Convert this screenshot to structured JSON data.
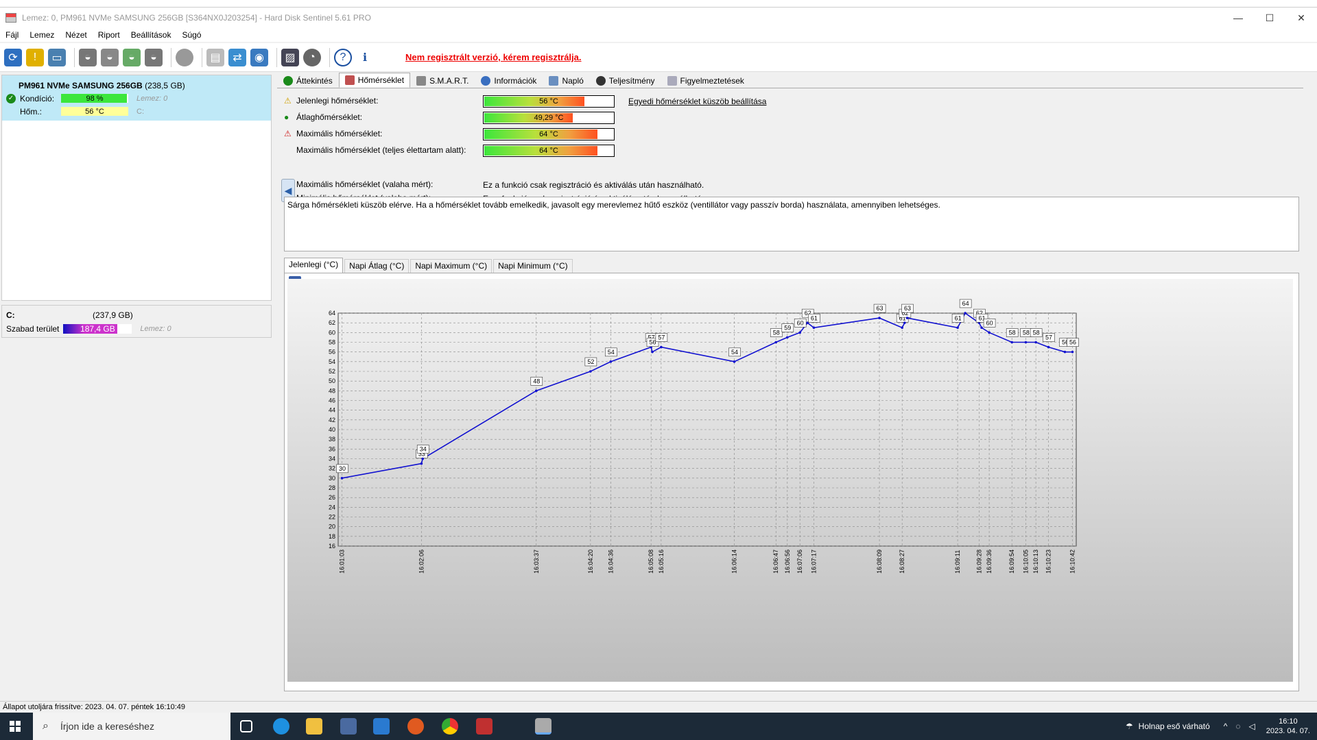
{
  "window": {
    "title": "Lemez: 0, PM961 NVMe SAMSUNG 256GB [S364NX0J203254]  -  Hard Disk Sentinel 5.61 PRO",
    "minimize": "—",
    "maximize": "☐",
    "close": "✕"
  },
  "menu": [
    "Fájl",
    "Lemez",
    "Nézet",
    "Riport",
    "Beállítások",
    "Súgó"
  ],
  "toolbar": {
    "unregistered_text": "Nem regisztrált verzió, kérem regisztrálja."
  },
  "disk": {
    "name": "PM961 NVMe SAMSUNG 256GB",
    "size": "(238,5 GB)",
    "health_label": "Kondíció:",
    "health_value": "98 %",
    "health_fraction": 0.98,
    "disk_label": "Lemez: 0",
    "temp_label": "Hőm.:",
    "temp_value": "56 °C",
    "drive_letter": "C:"
  },
  "volume": {
    "letter": "C:",
    "size": "(237,9 GB)",
    "free_label": "Szabad terület",
    "free_value": "187,4 GB",
    "free_fraction": 0.79,
    "disk_label": "Lemez: 0"
  },
  "tabs": [
    "Áttekintés",
    "Hőmérséklet",
    "S.M.A.R.T.",
    "Információk",
    "Napló",
    "Teljesítmény",
    "Figyelmeztetések"
  ],
  "temperature": {
    "rows": [
      {
        "label": "Jelenlegi hőmérséklet:",
        "value": "56 °C",
        "fraction": 0.77
      },
      {
        "label": "Átlaghőmérséklet:",
        "value": "49,29 °C",
        "fraction": 0.68
      },
      {
        "label": "Maximális hőmérséklet:",
        "value": "64 °C",
        "fraction": 0.87
      },
      {
        "label": "Maximális hőmérséklet (teljes élettartam alatt):",
        "value": "64 °C",
        "fraction": 0.87
      }
    ],
    "custom_link": "Egyedi hőmérséklet küszöb beállítása",
    "max_ever_label": "Maximális hőmérséklet (valaha mért):",
    "min_ever_label": "Minimális hőmérséklet (valaha mért):",
    "reg_only_text": "Ez a funkció csak regisztráció és aktiválás után használható.",
    "message": "Sárga hőmérsékleti küszöb elérve. Ha a hőmérséklet tovább emelkedik, javasolt egy merevlemez hűtő eszköz (ventillátor vagy passzív borda) használata, amennyiben lehetséges."
  },
  "chart_tabs": [
    "Jelenlegi (°C)",
    "Napi Átlag (°C)",
    "Napi Maximum (°C)",
    "Napi Minimum (°C)"
  ],
  "chart_data": {
    "type": "line",
    "title": "",
    "xlabel": "",
    "ylabel": "",
    "ylim": [
      16,
      64
    ],
    "yticks": [
      16,
      18,
      20,
      22,
      24,
      26,
      28,
      30,
      32,
      34,
      36,
      38,
      40,
      42,
      44,
      46,
      48,
      50,
      52,
      54,
      56,
      58,
      60,
      62,
      64
    ],
    "grid": true,
    "x": [
      "16:01:03",
      "16:02:06",
      "16:03:37",
      "16:04:20",
      "16:04:36",
      "16:05:08",
      "16:05:16",
      "16:06:14",
      "16:06:47",
      "16:06:56",
      "16:07:06",
      "16:07:17",
      "16:08:09",
      "16:08:27",
      "16:09:11",
      "16:09:28",
      "16:09:36",
      "16:09:54",
      "16:10:05",
      "16:10:13",
      "16:10:23",
      "16:10:42"
    ],
    "x_seconds": [
      63,
      126,
      217,
      260,
      276,
      308,
      316,
      374,
      407,
      416,
      426,
      437,
      489,
      507,
      551,
      568,
      576,
      594,
      605,
      613,
      623,
      642
    ],
    "points": [
      {
        "t": 63,
        "v": 30
      },
      {
        "t": 126,
        "v": 33
      },
      {
        "t": 127,
        "v": 34
      },
      {
        "t": 217,
        "v": 48
      },
      {
        "t": 260,
        "v": 52
      },
      {
        "t": 276,
        "v": 54
      },
      {
        "t": 308,
        "v": 57
      },
      {
        "t": 309,
        "v": 56
      },
      {
        "t": 316,
        "v": 57
      },
      {
        "t": 374,
        "v": 54
      },
      {
        "t": 407,
        "v": 58
      },
      {
        "t": 416,
        "v": 59
      },
      {
        "t": 426,
        "v": 60
      },
      {
        "t": 432,
        "v": 62
      },
      {
        "t": 437,
        "v": 61
      },
      {
        "t": 489,
        "v": 63
      },
      {
        "t": 507,
        "v": 61
      },
      {
        "t": 509,
        "v": 62
      },
      {
        "t": 511,
        "v": 63
      },
      {
        "t": 551,
        "v": 61
      },
      {
        "t": 557,
        "v": 64
      },
      {
        "t": 568,
        "v": 62
      },
      {
        "t": 570,
        "v": 61
      },
      {
        "t": 576,
        "v": 60
      },
      {
        "t": 594,
        "v": 58
      },
      {
        "t": 605,
        "v": 58
      },
      {
        "t": 613,
        "v": 58
      },
      {
        "t": 623,
        "v": 57
      },
      {
        "t": 636,
        "v": 56
      },
      {
        "t": 642,
        "v": 56
      }
    ],
    "line_color": "#1010d0"
  },
  "status": "Állapot utoljára frissítve: 2023. 04. 07. péntek 16:10:49",
  "taskbar": {
    "search_placeholder": "Írjon ide a kereséshez",
    "weather": "Holnap eső várható",
    "time": "16:10",
    "date": "2023. 04. 07."
  }
}
